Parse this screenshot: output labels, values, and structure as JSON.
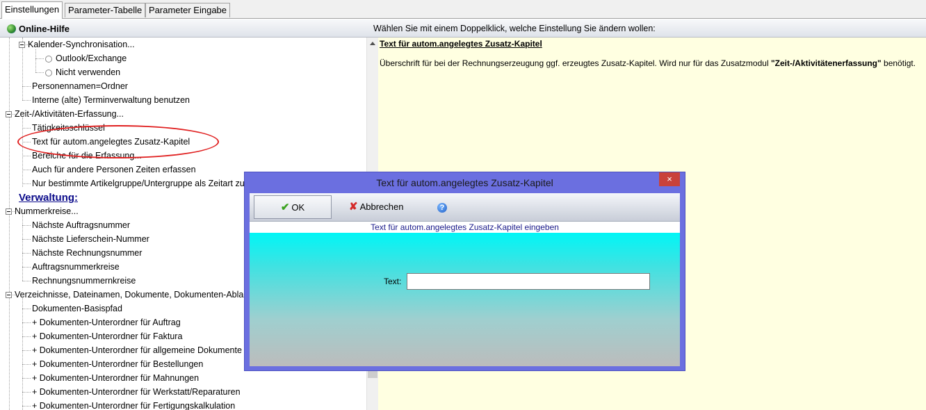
{
  "tabs": [
    "Einstellungen",
    "Parameter-Tabelle",
    "Parameter Eingabe"
  ],
  "header": {
    "help_label": "Online-Hilfe",
    "instruction": "Wählen Sie mit einem Doppelklick, welche Einstellung Sie ändern wollen:"
  },
  "tree": {
    "items": [
      "Kalender-Synchronisation...",
      "Outlook/Exchange",
      "Nicht verwenden",
      "Personennamen=Ordner",
      "Interne (alte) Terminverwaltung benutzen",
      "Zeit-/Aktivitäten-Erfassung...",
      "Tätigkeitsschlüssel",
      "Text für autom.angelegtes Zusatz-Kapitel",
      "Bereiche für die Erfassung...",
      "Auch für andere Personen Zeiten erfassen",
      "Nur bestimmte Artikelgruppe/Untergruppe als Zeitart zulassen",
      "Verwaltung:",
      "Nummerkreise...",
      "Nächste Auftragsnummer",
      "Nächste Lieferschein-Nummer",
      "Nächste Rechnungsnummer",
      "Auftragsnummerkreise",
      "Rechnungsnummernkreise",
      "Verzeichnisse, Dateinamen, Dokumente, Dokumenten-Ablage...",
      "Dokumenten-Basispfad",
      "+ Dokumenten-Unterordner für Auftrag",
      "+ Dokumenten-Unterordner für Faktura",
      "+ Dokumenten-Unterordner für allgemeine Dokumente",
      "+ Dokumenten-Unterordner für Bestellungen",
      "+ Dokumenten-Unterordner für Mahnungen",
      "+ Dokumenten-Unterordner für Werkstatt/Reparaturen",
      "+ Dokumenten-Unterordner für Fertigungskalkulation"
    ]
  },
  "info": {
    "title": "Text für autom.angelegtes Zusatz-Kapitel",
    "text_before": "Überschrift für bei der Rechnungserzeugung ggf. erzeugtes Zusatz-Kapitel. Wird nur für das Zusatzmodul ",
    "text_bold": "\"Zeit-/Aktivitätenerfassung\"",
    "text_after": " benötigt."
  },
  "dialog": {
    "title": "Text für autom.angelegtes Zusatz-Kapitel",
    "close": "×",
    "ok": "OK",
    "cancel": "Abbrechen",
    "help": "?",
    "subtitle": "Text für autom.angelegtes Zusatz-Kapitel eingeben",
    "field_label": "Text:",
    "field_value": ""
  }
}
